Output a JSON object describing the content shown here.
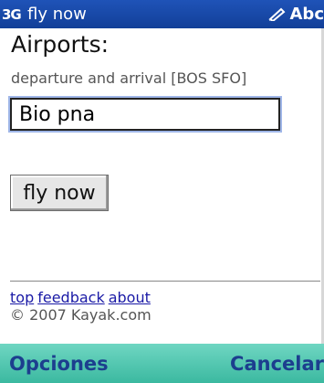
{
  "status_bar": {
    "network_badge": "3G",
    "title": "fly now",
    "input_mode": "Abc",
    "input_mode_icon": "pen-icon"
  },
  "form": {
    "heading": "Airports:",
    "hint": "departure and arrival [BOS SFO]",
    "airports_value": "Bio pna",
    "submit_label": "fly now"
  },
  "footer": {
    "links": [
      "top",
      "feedback",
      "about"
    ],
    "copyright": "© 2007 Kayak.com"
  },
  "softkeys": {
    "left": "Opciones",
    "right": "Cancelar"
  },
  "colors": {
    "status_bar": "#1a4aa8",
    "softkey_bar": "#4cc7ae",
    "softkey_text": "#1c3e8e",
    "link": "#1a1aa6"
  }
}
